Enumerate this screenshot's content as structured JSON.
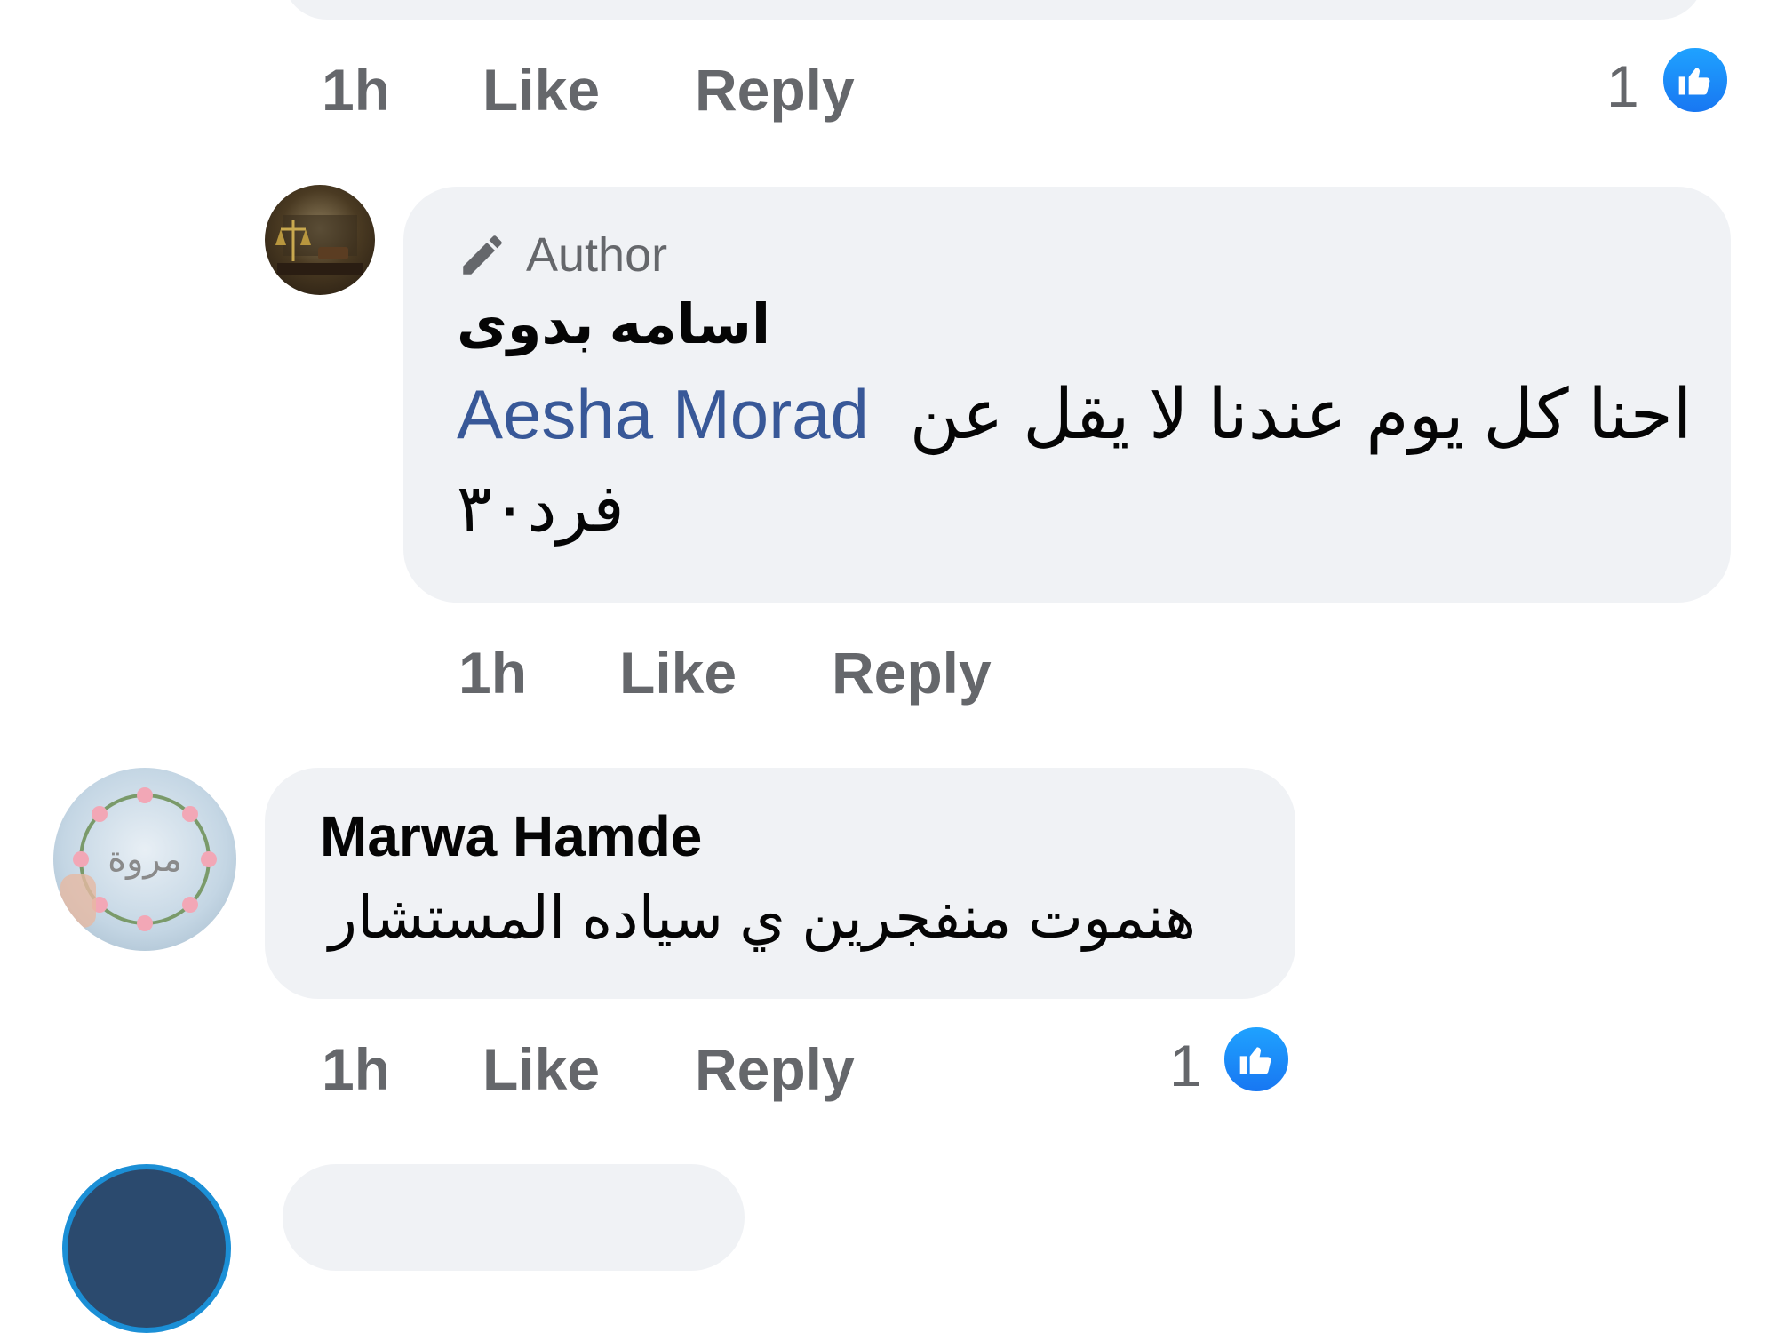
{
  "comments": [
    {
      "time": "1h",
      "like_label": "Like",
      "reply_label": "Reply",
      "reaction_count": "1"
    },
    {
      "badge": "Author",
      "author": "اسامه بدوى",
      "text_line1_prefix": "احنا كل يوم عندنا لا يقل عن",
      "mention": "Aesha Morad",
      "text_line2": "فرد٣٠",
      "time": "1h",
      "like_label": "Like",
      "reply_label": "Reply"
    },
    {
      "author": "Marwa Hamde",
      "avatar_text": "مروة",
      "text": "هنموت منفجرين ي سياده المستشار",
      "time": "1h",
      "like_label": "Like",
      "reply_label": "Reply",
      "reaction_count": "1"
    }
  ],
  "colors": {
    "bubble": "#f0f2f5",
    "meta_text": "#65676b",
    "mention": "#385898",
    "like_blue": "#1877f2"
  },
  "icons": [
    "thumbs-up-icon",
    "pencil-icon"
  ]
}
